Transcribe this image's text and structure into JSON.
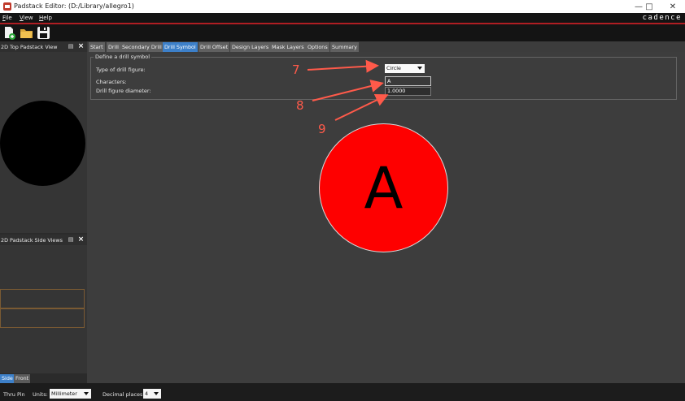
{
  "window": {
    "title": "Padstack Editor:  (D:/Library/allegro1)",
    "controls": [
      "minimize-icon",
      "maximize-icon",
      "close-icon"
    ]
  },
  "menu": {
    "file": "File",
    "view": "View",
    "help": "Help"
  },
  "brand": "cadence",
  "toolbar": {
    "icons": [
      "new-padstack-icon",
      "open-folder-icon",
      "save-icon"
    ]
  },
  "panels": {
    "top_view": {
      "title": "2D Top Padstack View"
    },
    "side_views": {
      "title": "2D Padstack Side Views"
    },
    "bottom_tabs": {
      "side": "Side",
      "front": "Front"
    }
  },
  "tabs": [
    "Start",
    "Drill",
    "Secondary Drill",
    "Drill Symbol",
    "Drill Offset",
    "Design Layers",
    "Mask Layers",
    "Options",
    "Summary"
  ],
  "active_tab": "Drill Symbol",
  "drill_symbol": {
    "group_title": "Define a drill symbol",
    "type_label": "Type of drill figure:",
    "type_value": "Circle",
    "characters_label": "Characters:",
    "characters_value": "A",
    "diameter_label": "Drill figure diameter:",
    "diameter_value": "1.0000"
  },
  "preview": {
    "character": "A",
    "fill_color": "#fe0000"
  },
  "annotations": {
    "callout_7": "7",
    "callout_8": "8",
    "callout_9": "9",
    "color": "#ff5a4a"
  },
  "status": {
    "pad_type": "Thru Pin",
    "units_label": "Units:",
    "units_value": "Millimeter",
    "decimal_label": "Decimal places:",
    "decimal_value": "4"
  }
}
